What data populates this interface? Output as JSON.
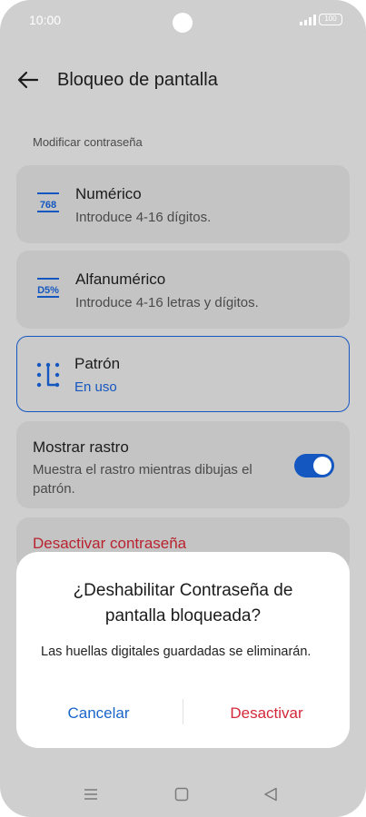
{
  "status_bar": {
    "time": "10:00",
    "battery": "100"
  },
  "header": {
    "title": "Bloqueo de pantalla"
  },
  "section": {
    "label": "Modificar contraseña"
  },
  "options": [
    {
      "icon_name": "numeric-768-icon",
      "icon_text": "768",
      "title": "Numérico",
      "subtitle": "Introduce 4-16 dígitos."
    },
    {
      "icon_name": "alphanumeric-d5-icon",
      "icon_text": "D5%",
      "title": "Alfanumérico",
      "subtitle": "Introduce 4-16 letras y dígitos."
    },
    {
      "icon_name": "pattern-icon",
      "title": "Patrón",
      "subtitle": "En uso"
    }
  ],
  "toggle_option": {
    "title": "Mostrar rastro",
    "subtitle": "Muestra el rastro mientras dibujas el patrón.",
    "enabled": true
  },
  "deactivate": {
    "label": "Desactivar contraseña"
  },
  "dialog": {
    "title": "¿Deshabilitar Contraseña de pantalla bloqueada?",
    "message": "Las huellas digitales guardadas se eliminarán.",
    "cancel_label": "Cancelar",
    "confirm_label": "Desactivar"
  },
  "colors": {
    "accent": "#1557c0",
    "danger": "#d3283a",
    "scrim_background": "#cfcfcf"
  },
  "nav_bar": {
    "items": [
      "menu-icon",
      "home-square-icon",
      "back-triangle-icon"
    ]
  }
}
